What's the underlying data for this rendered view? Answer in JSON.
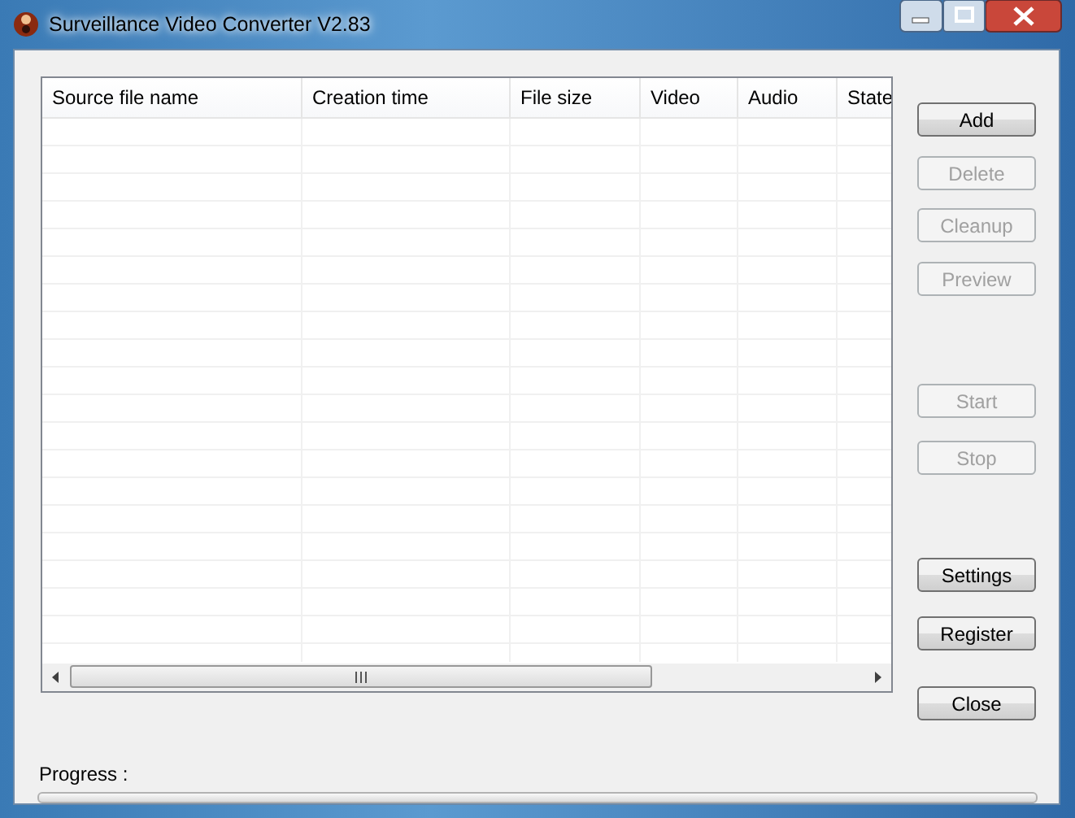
{
  "window": {
    "title": "Surveillance Video Converter V2.83"
  },
  "table": {
    "columns": [
      "Source file name",
      "Creation time",
      "File size",
      "Video",
      "Audio",
      "State"
    ]
  },
  "buttons": [
    {
      "label": "Add",
      "disabled": false
    },
    {
      "label": "Delete",
      "disabled": true
    },
    {
      "label": "Cleanup",
      "disabled": true
    },
    {
      "label": "Preview",
      "disabled": true
    },
    {
      "label": "Start",
      "disabled": true
    },
    {
      "label": "Stop",
      "disabled": true
    },
    {
      "label": "Settings",
      "disabled": false
    },
    {
      "label": "Register",
      "disabled": false
    },
    {
      "label": "Close",
      "disabled": false
    }
  ],
  "progress": {
    "label": "Progress :",
    "level": 0
  }
}
